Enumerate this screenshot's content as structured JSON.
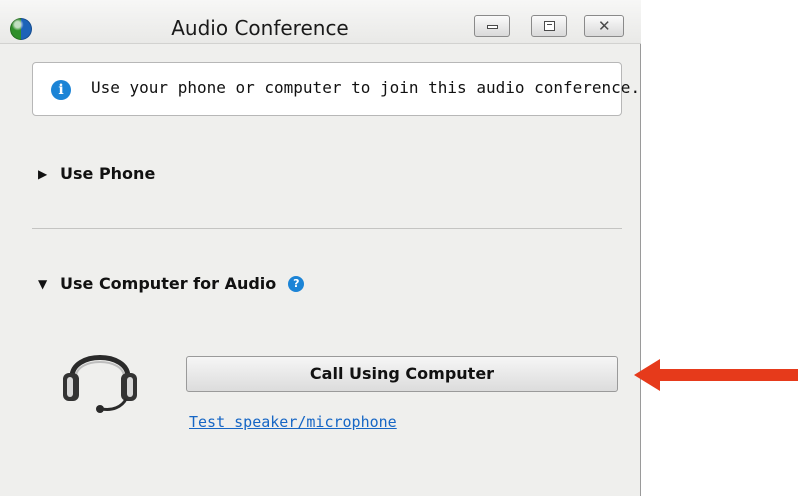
{
  "window": {
    "title": "Audio Conference"
  },
  "info": {
    "text": "Use your phone or computer to join this audio conference."
  },
  "sections": {
    "phone": {
      "label": "Use Phone",
      "expanded": false
    },
    "computer": {
      "label": "Use Computer for Audio",
      "expanded": true
    }
  },
  "actions": {
    "call_button": "Call Using Computer",
    "test_link": "Test speaker/microphone"
  },
  "icons": {
    "info": "info-icon",
    "help": "help-icon",
    "headset": "headset-icon",
    "annotation_arrow": "red-arrow"
  },
  "colors": {
    "accent_blue": "#1c84d6",
    "link": "#1666c5",
    "arrow": "#e63a1b"
  }
}
